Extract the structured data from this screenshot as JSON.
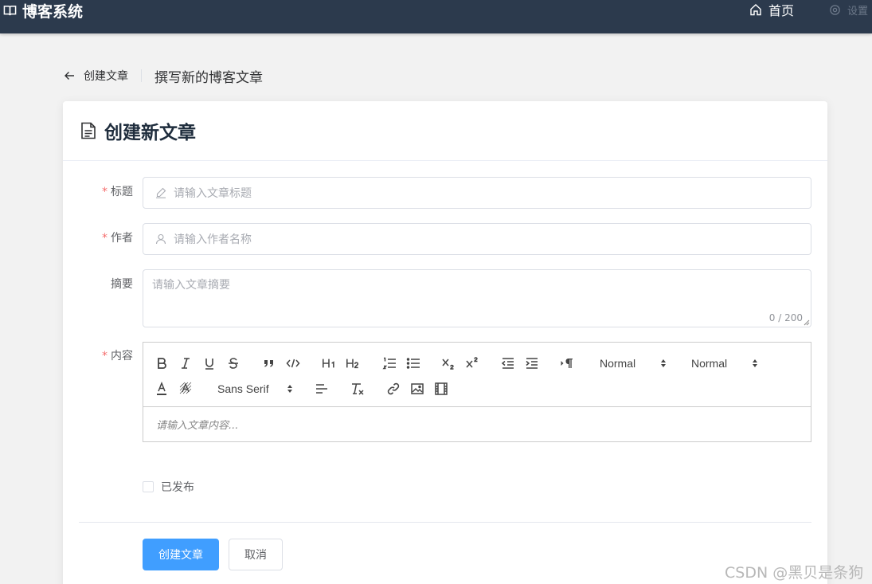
{
  "app": {
    "brand": "博客系统",
    "nav_home": "首页",
    "nav_settings": "设置"
  },
  "page_header": {
    "back_label": "创建文章",
    "subtitle": "撰写新的博客文章"
  },
  "card": {
    "title": "创建新文章"
  },
  "form": {
    "title_field": {
      "label": "标题",
      "required": true,
      "placeholder": "请输入文章标题"
    },
    "author_field": {
      "label": "作者",
      "required": true,
      "placeholder": "请输入作者名称"
    },
    "summary_field": {
      "label": "摘要",
      "required": false,
      "placeholder": "请输入文章摘要",
      "counter": "0 / 200"
    },
    "content_field": {
      "label": "内容",
      "required": true,
      "placeholder": "请输入文章内容..."
    },
    "published_checkbox": {
      "label": "已发布",
      "checked": false
    }
  },
  "editor_toolbar": {
    "header_picker": "Normal",
    "size_picker": "Normal",
    "font_picker": "Sans Serif",
    "buttons": [
      "bold-icon",
      "italic-icon",
      "underline-icon",
      "strike-icon",
      "blockquote-icon",
      "code-block-icon",
      "header-1-icon",
      "header-2-icon",
      "ordered-list-icon",
      "bullet-list-icon",
      "subscript-icon",
      "superscript-icon",
      "outdent-icon",
      "indent-icon",
      "rtl-direction-icon",
      "text-color-icon",
      "background-color-icon",
      "align-icon",
      "clean-format-icon",
      "link-icon",
      "image-icon",
      "video-icon"
    ]
  },
  "actions": {
    "submit_label": "创建文章",
    "cancel_label": "取消"
  },
  "watermark": "CSDN @黑贝是条狗",
  "colors": {
    "topbar": "#2c3a4d",
    "primary": "#409eff",
    "required": "#f56c6c"
  }
}
